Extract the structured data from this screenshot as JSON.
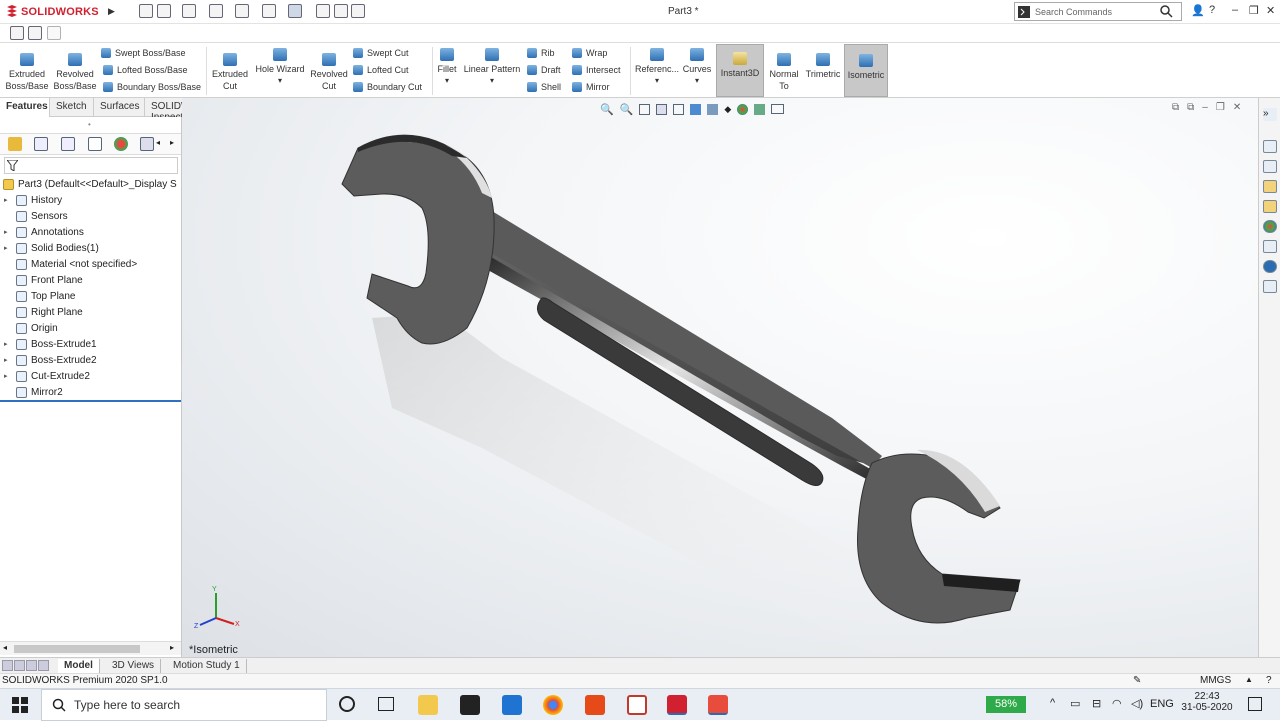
{
  "app": {
    "brand": "SOLIDWORKS",
    "document_title": "Part3 *",
    "search_placeholder": "Search Commands",
    "help_label": "?"
  },
  "commands": {
    "extruded_boss": "Extruded Boss/Base",
    "revolved_boss": "Revolved Boss/Base",
    "swept_boss": "Swept Boss/Base",
    "lofted_boss": "Lofted Boss/Base",
    "boundary_boss": "Boundary Boss/Base",
    "extruded_cut": "Extruded Cut",
    "hole_wizard": "Hole Wizard",
    "revolved_cut": "Revolved Cut",
    "swept_cut": "Swept Cut",
    "lofted_cut": "Lofted Cut",
    "boundary_cut": "Boundary Cut",
    "fillet": "Fillet",
    "linear_pattern": "Linear Pattern",
    "rib": "Rib",
    "draft": "Draft",
    "shell": "Shell",
    "wrap": "Wrap",
    "intersect": "Intersect",
    "mirror": "Mirror",
    "reference": "Referenc...",
    "curves": "Curves",
    "instant3d": "Instant3D",
    "normal_to": "Normal To",
    "trimetric": "Trimetric",
    "isometric": "Isometric"
  },
  "tabs": [
    "Features",
    "Sketch",
    "Surfaces",
    "SOLIDWORKS Inspection"
  ],
  "tree": {
    "root": "Part3  (Default<<Default>_Display S",
    "items": [
      {
        "label": "History",
        "expandable": true
      },
      {
        "label": "Sensors",
        "expandable": false
      },
      {
        "label": "Annotations",
        "expandable": true
      },
      {
        "label": "Solid Bodies(1)",
        "expandable": true
      },
      {
        "label": "Material <not specified>",
        "expandable": false
      },
      {
        "label": "Front Plane",
        "expandable": false
      },
      {
        "label": "Top Plane",
        "expandable": false
      },
      {
        "label": "Right Plane",
        "expandable": false
      },
      {
        "label": "Origin",
        "expandable": false
      },
      {
        "label": "Boss-Extrude1",
        "expandable": true
      },
      {
        "label": "Boss-Extrude2",
        "expandable": true
      },
      {
        "label": "Cut-Extrude2",
        "expandable": true
      },
      {
        "label": "Mirror2",
        "expandable": false
      }
    ]
  },
  "viewport": {
    "view_label": "*Isometric",
    "triad_labels": {
      "x": "X",
      "y": "Y",
      "z": "Z"
    }
  },
  "bottom_tabs": [
    "Model",
    "3D Views",
    "Motion Study 1"
  ],
  "status": {
    "version": "SOLIDWORKS Premium 2020 SP1.0",
    "units": "MMGS"
  },
  "taskbar": {
    "search_placeholder": "Type here to search",
    "battery": "58%",
    "language": "ENG",
    "time": "22:43",
    "date": "31-05-2020"
  },
  "colors": {
    "brand_red": "#d1202f",
    "accent_blue": "#2e6fb3",
    "active_button": "#c8c8c8"
  }
}
